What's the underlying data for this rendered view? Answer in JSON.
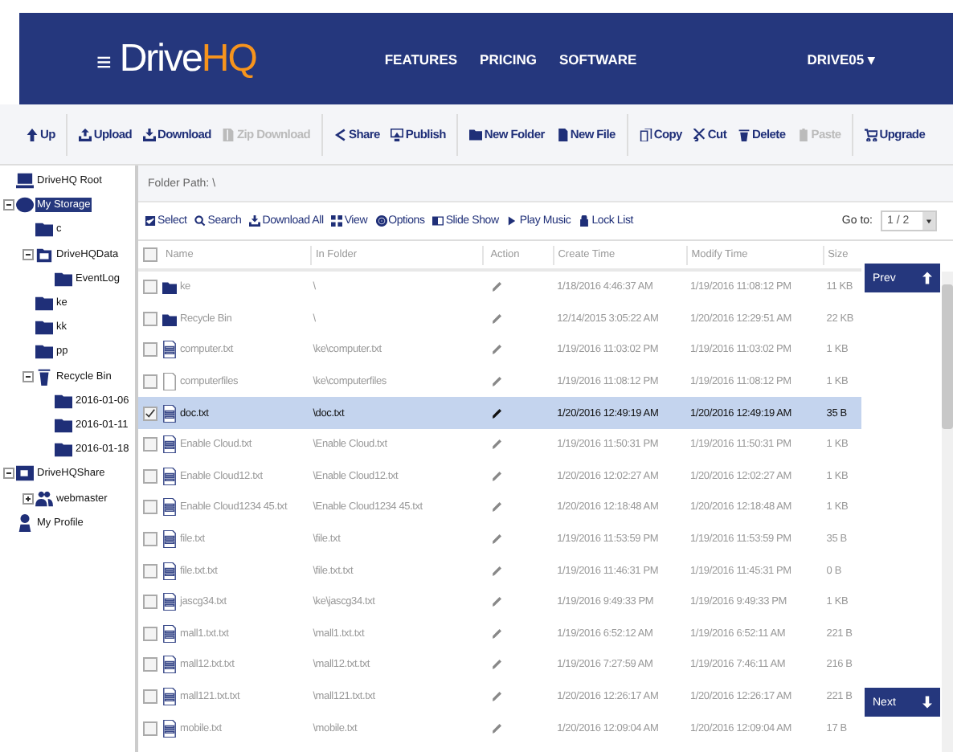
{
  "header": {
    "logo_main": "Drive",
    "logo_accent": "HQ",
    "menu_icon": "≡",
    "nav": [
      "FEATURES",
      "PRICING",
      "SOFTWARE"
    ],
    "user": "DRIVE05 ▾"
  },
  "toolbar": [
    {
      "label": "Up",
      "kind": "up",
      "disabled": false,
      "group_start": false
    },
    {
      "label": "Upload",
      "kind": "upload",
      "disabled": false,
      "group_start": true
    },
    {
      "label": "Download",
      "kind": "download",
      "disabled": false,
      "group_start": false
    },
    {
      "label": "Zip Download",
      "kind": "zip",
      "disabled": true,
      "group_start": false
    },
    {
      "label": "Share",
      "kind": "share",
      "disabled": false,
      "group_start": true
    },
    {
      "label": "Publish",
      "kind": "publish",
      "disabled": false,
      "group_start": false
    },
    {
      "label": "New Folder",
      "kind": "folder",
      "disabled": false,
      "group_start": true
    },
    {
      "label": "New File",
      "kind": "file",
      "disabled": false,
      "group_start": false
    },
    {
      "label": "Copy",
      "kind": "copy",
      "disabled": false,
      "group_start": true
    },
    {
      "label": "Cut",
      "kind": "cut",
      "disabled": false,
      "group_start": false
    },
    {
      "label": "Delete",
      "kind": "trash",
      "disabled": false,
      "group_start": false
    },
    {
      "label": "Paste",
      "kind": "paste",
      "disabled": true,
      "group_start": false
    },
    {
      "label": "Upgrade",
      "kind": "cart",
      "disabled": false,
      "group_start": true
    }
  ],
  "tree": [
    {
      "label": "DriveHQ Root",
      "kind": "drive",
      "selected": false
    },
    {
      "label": "My Storage",
      "kind": "storage",
      "selected": true,
      "expanded": true,
      "children": [
        {
          "label": "c",
          "kind": "folder",
          "selected": false
        },
        {
          "label": "DriveHQData",
          "kind": "folder-outline",
          "selected": false,
          "expanded": true,
          "children": [
            {
              "label": "EventLog",
              "kind": "folder",
              "selected": false
            }
          ]
        },
        {
          "label": "ke",
          "kind": "folder",
          "selected": false
        },
        {
          "label": "kk",
          "kind": "folder",
          "selected": false
        },
        {
          "label": "pp",
          "kind": "folder",
          "selected": false
        },
        {
          "label": "Recycle Bin",
          "kind": "trash",
          "selected": false,
          "expanded": true,
          "children": [
            {
              "label": "2016-01-06",
              "kind": "folder",
              "selected": false
            },
            {
              "label": "2016-01-11",
              "kind": "folder",
              "selected": false
            },
            {
              "label": "2016-01-18",
              "kind": "folder",
              "selected": false
            }
          ]
        }
      ]
    },
    {
      "label": "DriveHQShare",
      "kind": "share",
      "selected": false,
      "expanded": true,
      "children": [
        {
          "label": "webmaster",
          "kind": "users",
          "selected": false,
          "expanded": false
        }
      ]
    },
    {
      "label": "My Profile",
      "kind": "profile",
      "selected": false
    }
  ],
  "folder_path": "Folder Path: \\",
  "actions": [
    {
      "label": "Select",
      "kind": "check"
    },
    {
      "label": "Search",
      "kind": "search"
    },
    {
      "label": "Download All",
      "kind": "download"
    },
    {
      "label": "View",
      "kind": "grid"
    },
    {
      "label": "Options",
      "kind": "gear"
    },
    {
      "label": "Slide Show",
      "kind": "slides"
    },
    {
      "label": "Play Music",
      "kind": "play"
    },
    {
      "label": "Lock List",
      "kind": "lock"
    }
  ],
  "goto": {
    "label": "Go to:",
    "value": "1 / 2"
  },
  "select_all": {
    "checked": false
  },
  "columns": [
    "Name",
    "In Folder",
    "Action",
    "Create Time",
    "Modify Time",
    "Size"
  ],
  "rows": [
    {
      "kind": "folder",
      "name": "ke",
      "folder": "\\",
      "create": "1/18/2016 4:46:37 AM",
      "modify": "1/19/2016 11:08:12 PM",
      "size": "11 KB",
      "selected": false
    },
    {
      "kind": "folder",
      "name": "Recycle Bin",
      "folder": "\\",
      "create": "12/14/2015 3:05:22 AM",
      "modify": "1/20/2016 12:29:51 AM",
      "size": "22 KB",
      "selected": false
    },
    {
      "kind": "text",
      "name": "computer.txt",
      "folder": "\\ke\\computer.txt",
      "create": "1/19/2016 11:03:02 PM",
      "modify": "1/19/2016 11:03:02 PM",
      "size": "1 KB",
      "selected": false
    },
    {
      "kind": "unknown",
      "name": "computerfiles",
      "folder": "\\ke\\computerfiles",
      "create": "1/19/2016 11:08:12 PM",
      "modify": "1/19/2016 11:08:12 PM",
      "size": "1 KB",
      "selected": false
    },
    {
      "kind": "text",
      "name": "doc.txt",
      "folder": "\\doc.txt",
      "create": "1/20/2016 12:49:19 AM",
      "modify": "1/20/2016 12:49:19 AM",
      "size": "35 B",
      "selected": true
    },
    {
      "kind": "text",
      "name": "Enable Cloud.txt",
      "folder": "\\Enable Cloud.txt",
      "create": "1/19/2016 11:50:31 PM",
      "modify": "1/19/2016 11:50:31 PM",
      "size": "1 KB",
      "selected": false
    },
    {
      "kind": "text",
      "name": "Enable Cloud12.txt",
      "folder": "\\Enable Cloud12.txt",
      "create": "1/20/2016 12:02:27 AM",
      "modify": "1/20/2016 12:02:27 AM",
      "size": "1 KB",
      "selected": false
    },
    {
      "kind": "text",
      "name": "Enable Cloud1234 45.txt",
      "folder": "\\Enable Cloud1234 45.txt",
      "create": "1/20/2016 12:18:48 AM",
      "modify": "1/20/2016 12:18:48 AM",
      "size": "1 KB",
      "selected": false
    },
    {
      "kind": "text",
      "name": "file.txt",
      "folder": "\\file.txt",
      "create": "1/19/2016 11:53:59 PM",
      "modify": "1/19/2016 11:53:59 PM",
      "size": "35 B",
      "selected": false
    },
    {
      "kind": "text",
      "name": "file.txt.txt",
      "folder": "\\file.txt.txt",
      "create": "1/19/2016 11:46:31 PM",
      "modify": "1/19/2016 11:45:31 PM",
      "size": "0 B",
      "selected": false
    },
    {
      "kind": "text",
      "name": "jascg34.txt",
      "folder": "\\ke\\jascg34.txt",
      "create": "1/19/2016 9:49:33 PM",
      "modify": "1/19/2016 9:49:33 PM",
      "size": "1 KB",
      "selected": false
    },
    {
      "kind": "text",
      "name": "mall1.txt.txt",
      "folder": "\\mall1.txt.txt",
      "create": "1/19/2016 6:52:12 AM",
      "modify": "1/19/2016 6:52:11 AM",
      "size": "221 B",
      "selected": false
    },
    {
      "kind": "text",
      "name": "mall12.txt.txt",
      "folder": "\\mall12.txt.txt",
      "create": "1/19/2016 7:27:59 AM",
      "modify": "1/19/2016 7:46:11 AM",
      "size": "216 B",
      "selected": false
    },
    {
      "kind": "text",
      "name": "mall121.txt.txt",
      "folder": "\\mall121.txt.txt",
      "create": "1/20/2016 12:26:17 AM",
      "modify": "1/20/2016 12:26:17 AM",
      "size": "221 B",
      "selected": false
    },
    {
      "kind": "text",
      "name": "mobile.txt",
      "folder": "\\mobile.txt",
      "create": "1/20/2016 12:09:04 AM",
      "modify": "1/20/2016 12:09:04 AM",
      "size": "17 B",
      "selected": false
    }
  ],
  "prev": "Prev",
  "next": "Next"
}
